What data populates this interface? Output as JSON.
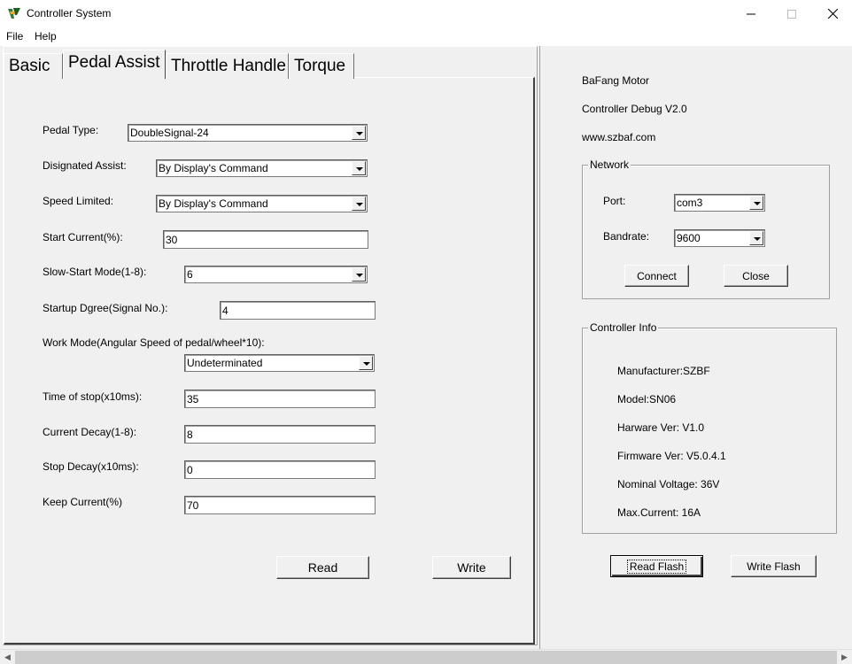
{
  "window": {
    "title": "Controller System",
    "icon": "app-logo-icon"
  },
  "menu": [
    "File",
    "Help"
  ],
  "tabs": [
    "Basic",
    "Pedal Assist",
    "Throttle Handle",
    "Torque"
  ],
  "active_tab": "Pedal Assist",
  "pedal_assist": {
    "pedal_type": {
      "label": "Pedal Type:",
      "value": "DoubleSignal-24"
    },
    "designated_assist": {
      "label": "Disignated Assist:",
      "value": "By Display's Command"
    },
    "speed_limited": {
      "label": "Speed Limited:",
      "value": "By Display's Command"
    },
    "start_current": {
      "label": "Start Current(%):",
      "value": "30"
    },
    "slow_start_mode": {
      "label": "Slow-Start Mode(1-8):",
      "value": "6"
    },
    "startup_degree": {
      "label": "Startup Dgree(Signal No.):",
      "value": "4"
    },
    "work_mode": {
      "label": "Work Mode(Angular Speed of pedal/wheel*10):",
      "value": "Undeterminated"
    },
    "time_of_stop": {
      "label": "Time of stop(x10ms):",
      "value": "35"
    },
    "current_decay": {
      "label": "Current Decay(1-8):",
      "value": "8"
    },
    "stop_decay": {
      "label": "Stop Decay(x10ms):",
      "value": "0"
    },
    "keep_current": {
      "label": "Keep Current(%)",
      "value": "70"
    },
    "read_label": "Read",
    "write_label": "Write"
  },
  "info": {
    "line1": "BaFang Motor",
    "line2": "Controller Debug V2.0",
    "line3": "www.szbaf.com"
  },
  "network": {
    "title": "Network",
    "port_label": "Port:",
    "port_value": "com3",
    "baud_label": "Bandrate:",
    "baud_value": "9600",
    "connect_label": "Connect",
    "close_label": "Close"
  },
  "controller_info": {
    "title": "Controller Info",
    "manufacturer": "Manufacturer:SZBF",
    "model": "Model:SN06",
    "hardware": "Harware Ver: V1.0",
    "firmware": "Firmware Ver: V5.0.4.1",
    "voltage": "Nominal Voltage: 36V",
    "current": "Max.Current: 16A"
  },
  "flash": {
    "read_label": "Read Flash",
    "write_label": "Write Flash"
  }
}
